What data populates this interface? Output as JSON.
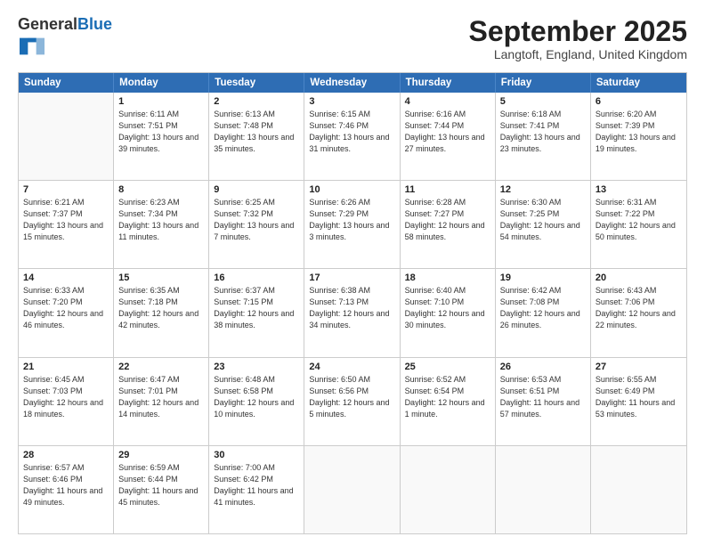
{
  "header": {
    "logo_general": "General",
    "logo_blue": "Blue",
    "month_title": "September 2025",
    "location": "Langtoft, England, United Kingdom"
  },
  "weekdays": [
    "Sunday",
    "Monday",
    "Tuesday",
    "Wednesday",
    "Thursday",
    "Friday",
    "Saturday"
  ],
  "rows": [
    [
      {
        "day": "",
        "sunrise": "",
        "sunset": "",
        "daylight": ""
      },
      {
        "day": "1",
        "sunrise": "Sunrise: 6:11 AM",
        "sunset": "Sunset: 7:51 PM",
        "daylight": "Daylight: 13 hours and 39 minutes."
      },
      {
        "day": "2",
        "sunrise": "Sunrise: 6:13 AM",
        "sunset": "Sunset: 7:48 PM",
        "daylight": "Daylight: 13 hours and 35 minutes."
      },
      {
        "day": "3",
        "sunrise": "Sunrise: 6:15 AM",
        "sunset": "Sunset: 7:46 PM",
        "daylight": "Daylight: 13 hours and 31 minutes."
      },
      {
        "day": "4",
        "sunrise": "Sunrise: 6:16 AM",
        "sunset": "Sunset: 7:44 PM",
        "daylight": "Daylight: 13 hours and 27 minutes."
      },
      {
        "day": "5",
        "sunrise": "Sunrise: 6:18 AM",
        "sunset": "Sunset: 7:41 PM",
        "daylight": "Daylight: 13 hours and 23 minutes."
      },
      {
        "day": "6",
        "sunrise": "Sunrise: 6:20 AM",
        "sunset": "Sunset: 7:39 PM",
        "daylight": "Daylight: 13 hours and 19 minutes."
      }
    ],
    [
      {
        "day": "7",
        "sunrise": "Sunrise: 6:21 AM",
        "sunset": "Sunset: 7:37 PM",
        "daylight": "Daylight: 13 hours and 15 minutes."
      },
      {
        "day": "8",
        "sunrise": "Sunrise: 6:23 AM",
        "sunset": "Sunset: 7:34 PM",
        "daylight": "Daylight: 13 hours and 11 minutes."
      },
      {
        "day": "9",
        "sunrise": "Sunrise: 6:25 AM",
        "sunset": "Sunset: 7:32 PM",
        "daylight": "Daylight: 13 hours and 7 minutes."
      },
      {
        "day": "10",
        "sunrise": "Sunrise: 6:26 AM",
        "sunset": "Sunset: 7:29 PM",
        "daylight": "Daylight: 13 hours and 3 minutes."
      },
      {
        "day": "11",
        "sunrise": "Sunrise: 6:28 AM",
        "sunset": "Sunset: 7:27 PM",
        "daylight": "Daylight: 12 hours and 58 minutes."
      },
      {
        "day": "12",
        "sunrise": "Sunrise: 6:30 AM",
        "sunset": "Sunset: 7:25 PM",
        "daylight": "Daylight: 12 hours and 54 minutes."
      },
      {
        "day": "13",
        "sunrise": "Sunrise: 6:31 AM",
        "sunset": "Sunset: 7:22 PM",
        "daylight": "Daylight: 12 hours and 50 minutes."
      }
    ],
    [
      {
        "day": "14",
        "sunrise": "Sunrise: 6:33 AM",
        "sunset": "Sunset: 7:20 PM",
        "daylight": "Daylight: 12 hours and 46 minutes."
      },
      {
        "day": "15",
        "sunrise": "Sunrise: 6:35 AM",
        "sunset": "Sunset: 7:18 PM",
        "daylight": "Daylight: 12 hours and 42 minutes."
      },
      {
        "day": "16",
        "sunrise": "Sunrise: 6:37 AM",
        "sunset": "Sunset: 7:15 PM",
        "daylight": "Daylight: 12 hours and 38 minutes."
      },
      {
        "day": "17",
        "sunrise": "Sunrise: 6:38 AM",
        "sunset": "Sunset: 7:13 PM",
        "daylight": "Daylight: 12 hours and 34 minutes."
      },
      {
        "day": "18",
        "sunrise": "Sunrise: 6:40 AM",
        "sunset": "Sunset: 7:10 PM",
        "daylight": "Daylight: 12 hours and 30 minutes."
      },
      {
        "day": "19",
        "sunrise": "Sunrise: 6:42 AM",
        "sunset": "Sunset: 7:08 PM",
        "daylight": "Daylight: 12 hours and 26 minutes."
      },
      {
        "day": "20",
        "sunrise": "Sunrise: 6:43 AM",
        "sunset": "Sunset: 7:06 PM",
        "daylight": "Daylight: 12 hours and 22 minutes."
      }
    ],
    [
      {
        "day": "21",
        "sunrise": "Sunrise: 6:45 AM",
        "sunset": "Sunset: 7:03 PM",
        "daylight": "Daylight: 12 hours and 18 minutes."
      },
      {
        "day": "22",
        "sunrise": "Sunrise: 6:47 AM",
        "sunset": "Sunset: 7:01 PM",
        "daylight": "Daylight: 12 hours and 14 minutes."
      },
      {
        "day": "23",
        "sunrise": "Sunrise: 6:48 AM",
        "sunset": "Sunset: 6:58 PM",
        "daylight": "Daylight: 12 hours and 10 minutes."
      },
      {
        "day": "24",
        "sunrise": "Sunrise: 6:50 AM",
        "sunset": "Sunset: 6:56 PM",
        "daylight": "Daylight: 12 hours and 5 minutes."
      },
      {
        "day": "25",
        "sunrise": "Sunrise: 6:52 AM",
        "sunset": "Sunset: 6:54 PM",
        "daylight": "Daylight: 12 hours and 1 minute."
      },
      {
        "day": "26",
        "sunrise": "Sunrise: 6:53 AM",
        "sunset": "Sunset: 6:51 PM",
        "daylight": "Daylight: 11 hours and 57 minutes."
      },
      {
        "day": "27",
        "sunrise": "Sunrise: 6:55 AM",
        "sunset": "Sunset: 6:49 PM",
        "daylight": "Daylight: 11 hours and 53 minutes."
      }
    ],
    [
      {
        "day": "28",
        "sunrise": "Sunrise: 6:57 AM",
        "sunset": "Sunset: 6:46 PM",
        "daylight": "Daylight: 11 hours and 49 minutes."
      },
      {
        "day": "29",
        "sunrise": "Sunrise: 6:59 AM",
        "sunset": "Sunset: 6:44 PM",
        "daylight": "Daylight: 11 hours and 45 minutes."
      },
      {
        "day": "30",
        "sunrise": "Sunrise: 7:00 AM",
        "sunset": "Sunset: 6:42 PM",
        "daylight": "Daylight: 11 hours and 41 minutes."
      },
      {
        "day": "",
        "sunrise": "",
        "sunset": "",
        "daylight": ""
      },
      {
        "day": "",
        "sunrise": "",
        "sunset": "",
        "daylight": ""
      },
      {
        "day": "",
        "sunrise": "",
        "sunset": "",
        "daylight": ""
      },
      {
        "day": "",
        "sunrise": "",
        "sunset": "",
        "daylight": ""
      }
    ]
  ]
}
